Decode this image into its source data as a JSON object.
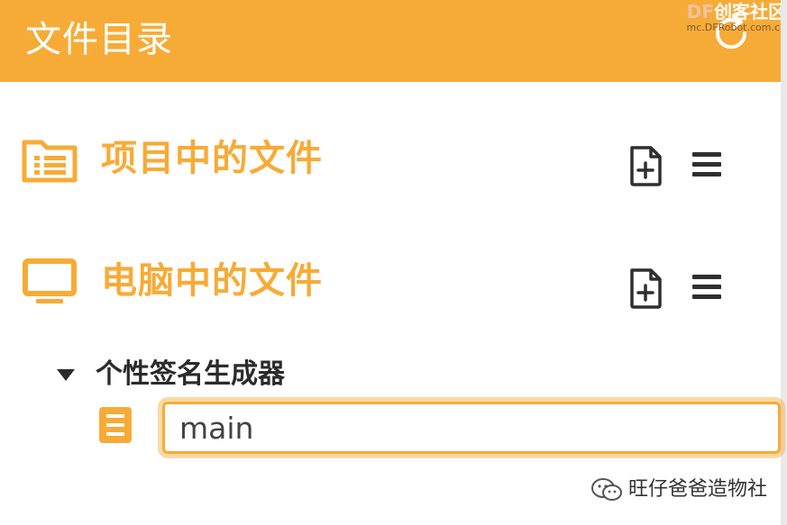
{
  "header": {
    "title": "文件目录",
    "refresh_icon": "refresh-icon"
  },
  "watermark_top": {
    "brand_prefix": "DF",
    "brand_rest": "创客社区",
    "url": "mc.DFRobot.com.cn"
  },
  "sections": [
    {
      "label": "项目中的文件",
      "icon": "folder-list-icon",
      "new_file_icon": "new-file-icon",
      "menu_icon": "menu-icon"
    },
    {
      "label": "电脑中的文件",
      "icon": "monitor-icon",
      "new_file_icon": "new-file-icon",
      "menu_icon": "menu-icon"
    }
  ],
  "tree": {
    "folder_label": "个性签名生成器",
    "expanded": true,
    "file_icon": "file-lines-icon",
    "file_name_value": "main"
  },
  "watermark_bottom": {
    "text": "旺仔爸爸造物社",
    "icon": "wechat-icon"
  },
  "colors": {
    "accent": "#f7ab37",
    "header_text": "#ffffff",
    "dark_text": "#2b2b2b",
    "icon_dark": "#2f2f2f"
  }
}
